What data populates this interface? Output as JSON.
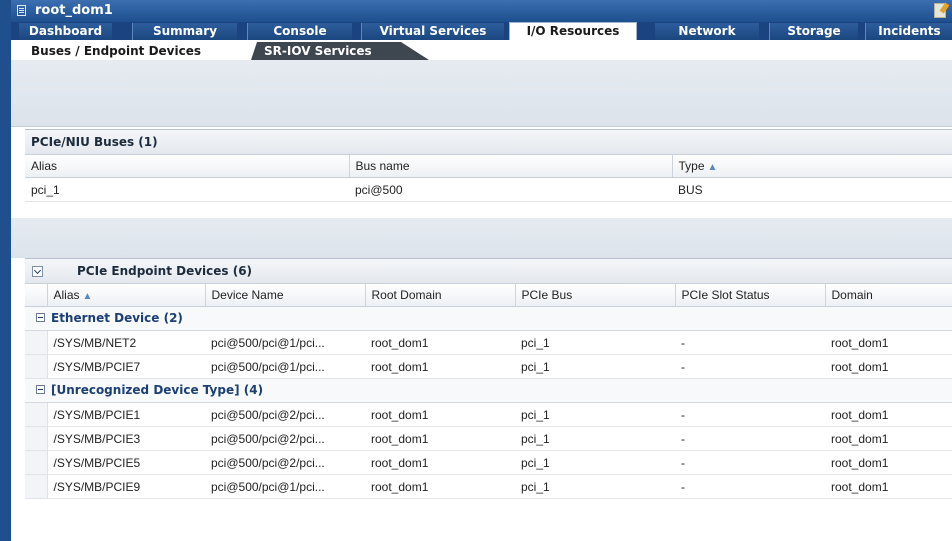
{
  "window": {
    "title": "root_dom1"
  },
  "tabs": [
    {
      "label": "Dashboard"
    },
    {
      "label": "Summary"
    },
    {
      "label": "Console"
    },
    {
      "label": "Virtual Services"
    },
    {
      "label": "I/O Resources"
    },
    {
      "label": "Network"
    },
    {
      "label": "Storage"
    },
    {
      "label": "Incidents"
    }
  ],
  "subtabs": [
    {
      "label": "Buses / Endpoint Devices"
    },
    {
      "label": "SR-IOV Services"
    }
  ],
  "buses": {
    "title": "PCIe/NIU Buses (1)",
    "columns": [
      "Alias",
      "Bus name",
      "Type"
    ],
    "rows": [
      {
        "alias": "pci_1",
        "bus": "pci@500",
        "type": "BUS"
      }
    ]
  },
  "endpoints": {
    "title": "PCIe Endpoint Devices (6)",
    "columns": [
      "Alias",
      "Device Name",
      "Root Domain",
      "PCIe Bus",
      "PCIe Slot Status",
      "Domain"
    ],
    "groups": [
      {
        "label": "Ethernet Device (2)",
        "rows": [
          {
            "alias": "/SYS/MB/NET2",
            "device": "pci@500/pci@1/pci...",
            "root": "root_dom1",
            "bus": "pci_1",
            "slot": "-",
            "domain": "root_dom1"
          },
          {
            "alias": "/SYS/MB/PCIE7",
            "device": "pci@500/pci@1/pci...",
            "root": "root_dom1",
            "bus": "pci_1",
            "slot": "-",
            "domain": "root_dom1"
          }
        ]
      },
      {
        "label": "[Unrecognized Device Type] (4)",
        "rows": [
          {
            "alias": "/SYS/MB/PCIE1",
            "device": "pci@500/pci@2/pci...",
            "root": "root_dom1",
            "bus": "pci_1",
            "slot": "-",
            "domain": "root_dom1"
          },
          {
            "alias": "/SYS/MB/PCIE3",
            "device": "pci@500/pci@2/pci...",
            "root": "root_dom1",
            "bus": "pci_1",
            "slot": "-",
            "domain": "root_dom1"
          },
          {
            "alias": "/SYS/MB/PCIE5",
            "device": "pci@500/pci@2/pci...",
            "root": "root_dom1",
            "bus": "pci_1",
            "slot": "-",
            "domain": "root_dom1"
          },
          {
            "alias": "/SYS/MB/PCIE9",
            "device": "pci@500/pci@1/pci...",
            "root": "root_dom1",
            "bus": "pci_1",
            "slot": "-",
            "domain": "root_dom1"
          }
        ]
      }
    ]
  }
}
